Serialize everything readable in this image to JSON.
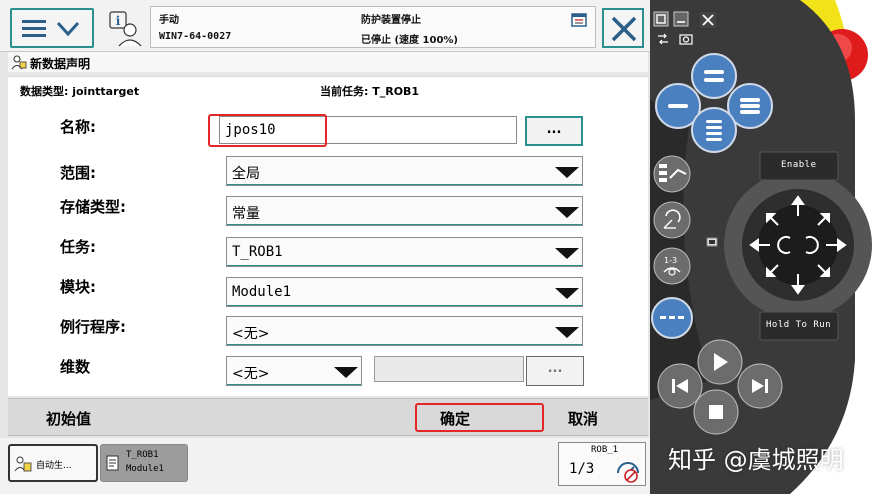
{
  "header": {
    "mode_label": "手动",
    "controller_id": "WIN7-64-0027",
    "safety_status": "防护装置停止",
    "run_status": "已停止 (速度 100%)"
  },
  "window_title": "新数据声明",
  "meta": {
    "data_type_label": "数据类型: jointtarget",
    "current_task_label": "当前任务: T_ROB1"
  },
  "form": {
    "name_label": "名称:",
    "name_value": "jpos10",
    "name_button": "...",
    "scope_label": "范围:",
    "scope_value": "全局",
    "storage_label": "存储类型:",
    "storage_value": "常量",
    "task_label": "任务:",
    "task_value": "T_ROB1",
    "module_label": "模块:",
    "module_value": "Module1",
    "routine_label": "例行程序:",
    "routine_value": "<无>",
    "dimension_label": "维数",
    "dimension_value": "<无>",
    "dimension_button": "..."
  },
  "bottom_bar": {
    "initial_value": "初始值",
    "ok": "确定",
    "cancel": "取消"
  },
  "taskbar": {
    "auto_task": "自动生...",
    "tab_line1": "T_ROB1",
    "tab_line2": "Module1",
    "rob_label": "ROB_1",
    "fraction": "1/3"
  },
  "hardware": {
    "enable_label": "Enable",
    "hold_to_run_label": "Hold To Run"
  },
  "watermark": "知乎 @虞城照明",
  "colors": {
    "accent": "#2b8f8f",
    "highlight": "#e32626",
    "pendant_body": "#2f2f2f",
    "button_blue": "#4a7fc0",
    "estop_red": "#e01b1b",
    "estop_yellow": "#f2e21a"
  }
}
